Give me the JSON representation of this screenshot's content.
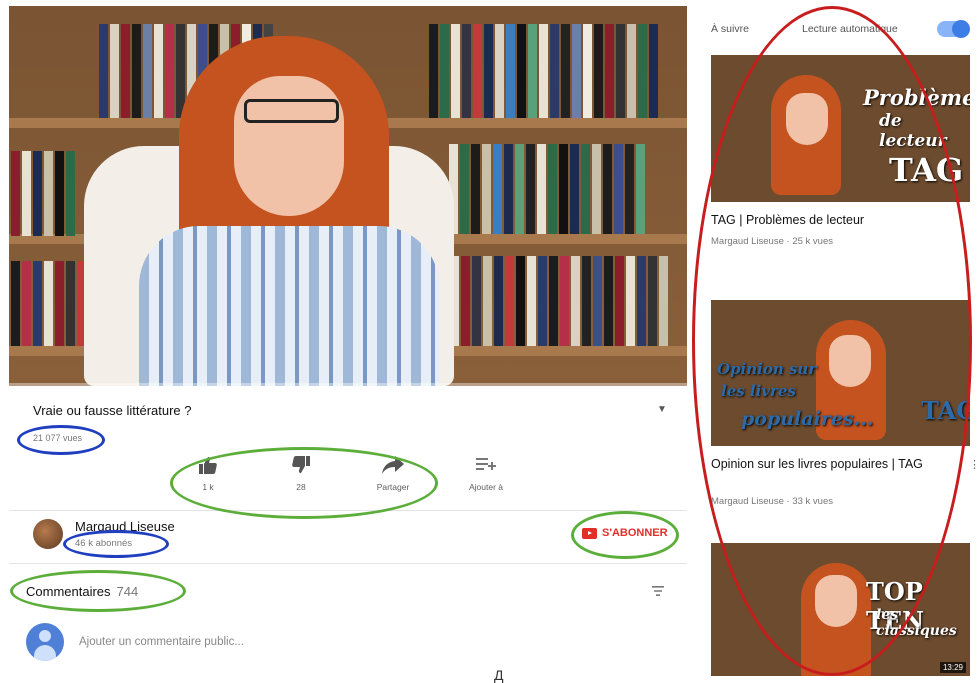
{
  "video": {
    "title": "Vraie ou fausse littérature ?",
    "views": "21 077 vues"
  },
  "actions": [
    {
      "icon": "thumbs-up-icon",
      "label": "1 k"
    },
    {
      "icon": "thumbs-down-icon",
      "label": "28"
    },
    {
      "icon": "share-icon",
      "label": "Partager"
    },
    {
      "icon": "add-to-playlist-icon",
      "label": "Ajouter à"
    }
  ],
  "channel": {
    "name": "Margaud Liseuse",
    "subscribers": "46 k abonnés",
    "subscribe_label": "S'ABONNER"
  },
  "comments": {
    "label": "Commentaires",
    "count": "744",
    "placeholder": "Ajouter un commentaire public..."
  },
  "sidebar": {
    "up_next": "À suivre",
    "autoplay": "Lecture automatique",
    "autoplay_on": true,
    "videos": [
      {
        "title": "TAG | Problèmes de lecteur",
        "meta": "Margaud Liseuse · 25 k vues",
        "overlay": [
          "Problèmes",
          "de lecteur",
          "TAG"
        ]
      },
      {
        "title": "Opinion sur les livres populaires | TAG",
        "meta": "Margaud Liseuse · 33 k vues",
        "overlay": [
          "Opinion sur",
          "les livres",
          "populaires...",
          "TAG"
        ]
      },
      {
        "title": "",
        "meta": "",
        "overlay": [
          "TOP TEN",
          "les classiques"
        ],
        "duration": "13:29"
      }
    ]
  },
  "colors": {
    "annotation_blue": "#1f3fbf",
    "annotation_green": "#5cae3a",
    "annotation_red": "#c81d1d",
    "subscribe_red": "#e52d27"
  }
}
